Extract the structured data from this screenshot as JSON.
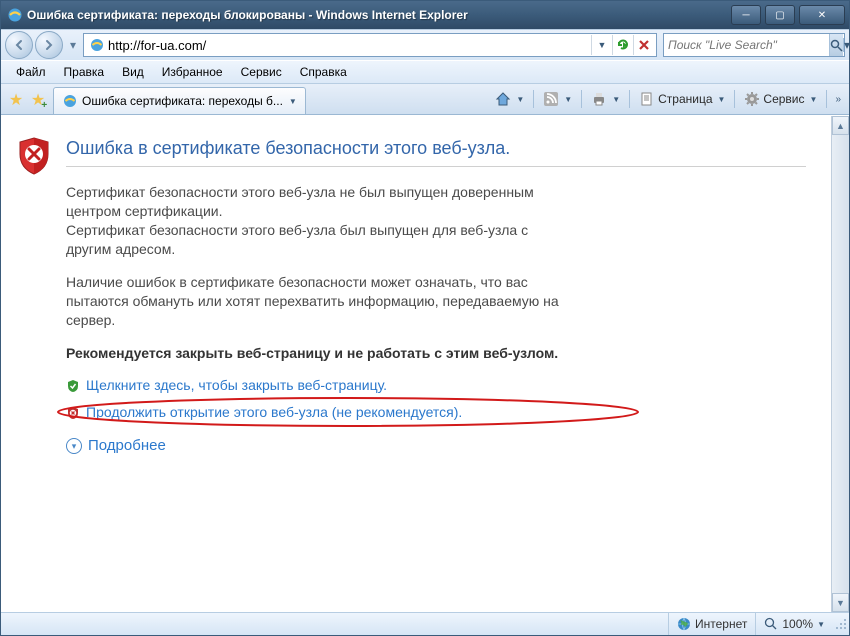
{
  "window": {
    "title": "Ошибка сертификата: переходы блокированы - Windows Internet Explorer"
  },
  "address": {
    "url": "http://for-ua.com/"
  },
  "search": {
    "placeholder": "Поиск \"Live Search\""
  },
  "menu": {
    "file": "Файл",
    "edit": "Правка",
    "view": "Вид",
    "favorites": "Избранное",
    "tools": "Сервис",
    "help": "Справка"
  },
  "tab": {
    "title": "Ошибка сертификата: переходы б..."
  },
  "cmd": {
    "page": "Страница",
    "tools": "Сервис"
  },
  "cert": {
    "title": "Ошибка в сертификате безопасности этого веб-узла.",
    "p1a": "Сертификат безопасности этого веб-узла не был выпущен доверенным центром сертификации.",
    "p1b": "Сертификат безопасности этого веб-узла был выпущен для веб-узла с другим адресом.",
    "p2": "Наличие ошибок в сертификате безопасности может означать, что вас пытаются обмануть или хотят перехватить информацию, передаваемую на сервер.",
    "recommend": "Рекомендуется закрыть веб-страницу и не работать с этим веб-узлом.",
    "close_link": "Щелкните здесь, чтобы закрыть веб-страницу.",
    "continue_link": "Продолжить открытие этого веб-узла (не рекомендуется).",
    "more": "Подробнее"
  },
  "status": {
    "zone": "Интернет",
    "zoom": "100%"
  }
}
